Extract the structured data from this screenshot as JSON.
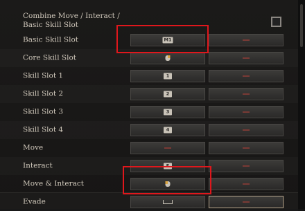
{
  "combine_label": "Combine Move / Interact / Basic Skill Slot",
  "rows": [
    {
      "label": "Basic Skill Slot",
      "primary": "M1",
      "primary_type": "key",
      "secondary": "—"
    },
    {
      "label": "Core Skill Slot",
      "primary": "mouse",
      "primary_type": "mouse",
      "secondary": "—"
    },
    {
      "label": "Skill Slot 1",
      "primary": "1",
      "primary_type": "key",
      "secondary": "—"
    },
    {
      "label": "Skill Slot 2",
      "primary": "2",
      "primary_type": "key",
      "secondary": "—"
    },
    {
      "label": "Skill Slot 3",
      "primary": "3",
      "primary_type": "key",
      "secondary": "—"
    },
    {
      "label": "Skill Slot 4",
      "primary": "4",
      "primary_type": "key",
      "secondary": "—"
    },
    {
      "label": "Move",
      "primary": "—",
      "primary_type": "none",
      "secondary": "—"
    },
    {
      "label": "Interact",
      "primary": "E",
      "primary_type": "key",
      "secondary": "—"
    },
    {
      "label": "Move & Interact",
      "primary": "mouse",
      "primary_type": "mouse",
      "secondary": "—"
    },
    {
      "label": "Evade",
      "primary": "space",
      "primary_type": "space",
      "secondary": "—"
    }
  ],
  "colors": {
    "highlight": "#e0171c",
    "unbound_dash": "#7a3a35",
    "text": "#cfc7ba"
  }
}
